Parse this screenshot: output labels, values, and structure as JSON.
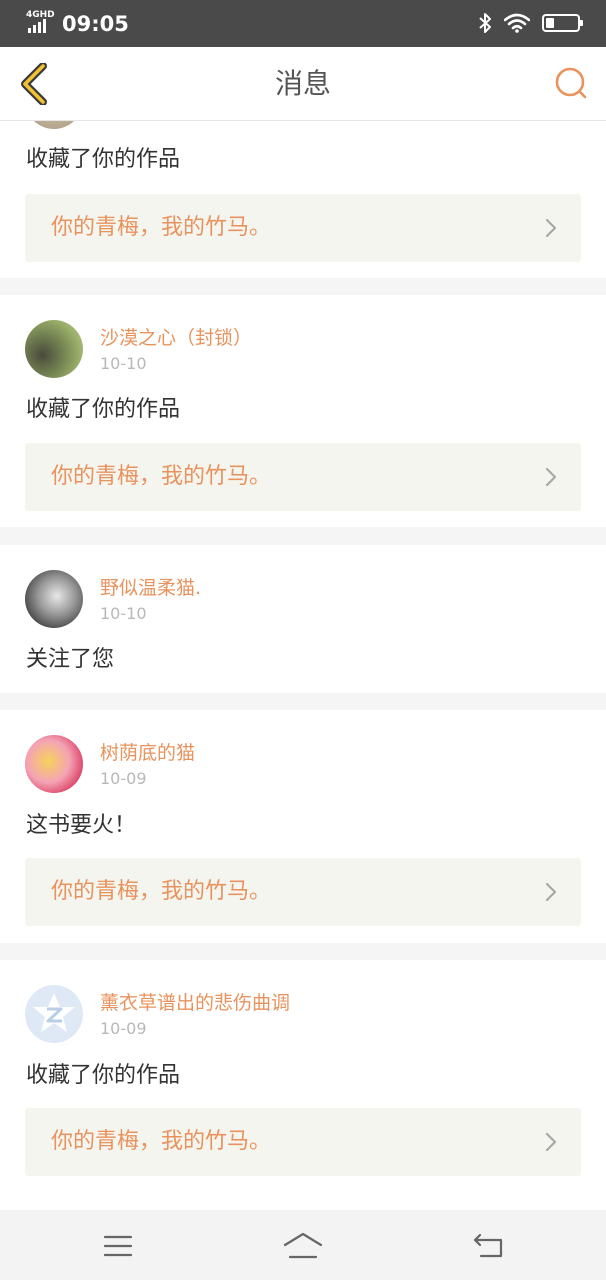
{
  "status_bar": {
    "network_tag": "4GHD",
    "time": "09:05",
    "icons": [
      "signal-icon",
      "bluetooth-icon",
      "wifi-icon",
      "battery-icon"
    ]
  },
  "header": {
    "title": "消息",
    "back_icon": "chevron-left-icon",
    "search_icon": "search-icon",
    "accent_color": "#e8935d"
  },
  "messages": [
    {
      "user": "",
      "date": "",
      "action": "收藏了你的作品",
      "work_title": "你的青梅，我的竹马。"
    },
    {
      "user": "沙漠之心（封锁）",
      "date": "10-10",
      "action": "收藏了你的作品",
      "work_title": "你的青梅，我的竹马。"
    },
    {
      "user": "野似温柔猫.",
      "date": "10-10",
      "action": "关注了您"
    },
    {
      "user": "树荫底的猫",
      "date": "10-09",
      "action": "这书要火！",
      "work_title": "你的青梅，我的竹马。"
    },
    {
      "user": "薰衣草谱出的悲伤曲调",
      "date": "10-09",
      "action": "收藏了你的作品",
      "work_title": "你的青梅，我的竹马。"
    }
  ],
  "nav_bar": {
    "icons": [
      "menu-icon",
      "home-icon",
      "back-icon"
    ]
  }
}
